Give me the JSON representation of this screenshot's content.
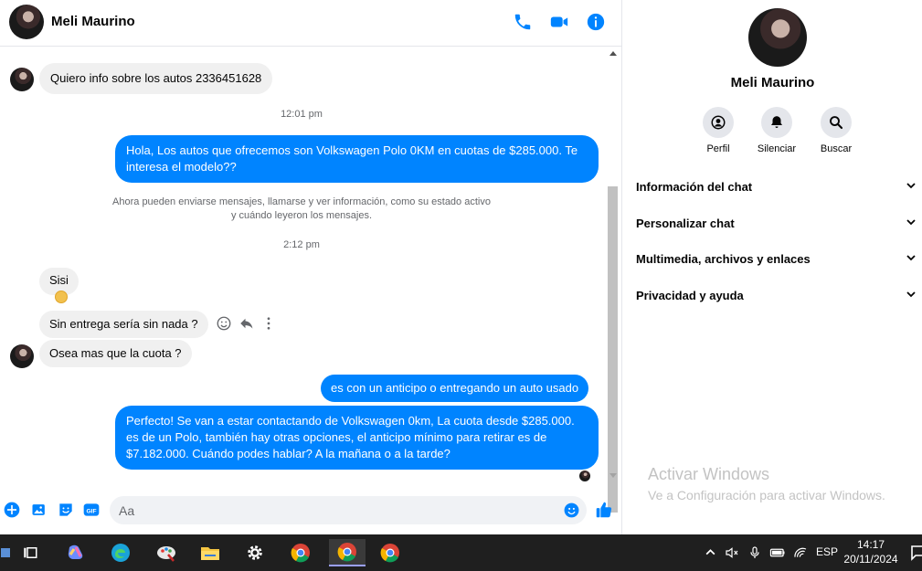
{
  "header": {
    "contact_name": "Meli Maurino"
  },
  "messages": [
    {
      "id": "m1",
      "dir": "in",
      "text": "Quiero info sobre los autos 2336451628"
    },
    {
      "id": "t1",
      "text": "12:01 pm"
    },
    {
      "id": "m2",
      "dir": "out",
      "text": "Hola, Los autos que ofrecemos son Volkswagen Polo 0KM en cuotas de $285.000. Te interesa el modelo??"
    },
    {
      "id": "sys",
      "line1": "Ahora pueden enviarse mensajes, llamarse y ver información, como su estado activo",
      "line2": "y cuándo leyeron los mensajes."
    },
    {
      "id": "t2",
      "text": "2:12 pm"
    },
    {
      "id": "m3",
      "dir": "in",
      "text": "Sisi"
    },
    {
      "id": "m4",
      "dir": "in",
      "text": "Sin entrega sería sin nada ?"
    },
    {
      "id": "m5",
      "dir": "in",
      "text": "Osea mas que la cuota ?"
    },
    {
      "id": "m6",
      "dir": "out",
      "text": "es con un anticipo o entregando un auto usado"
    },
    {
      "id": "m7",
      "dir": "out",
      "line1": "Perfecto!  Se van a estar contactando de Volkswagen 0km, La cuota desde $285.000.",
      "line2": "es de un Polo, también hay otras opciones, el anticipo mínimo para retirar es de",
      "line3": "$7.182.000. Cuándo podes hablar? A la mañana o a la tarde?"
    }
  ],
  "composer": {
    "placeholder": "Aa"
  },
  "sidebar": {
    "name": "Meli Maurino",
    "actions": [
      {
        "label": "Perfil"
      },
      {
        "label": "Silenciar"
      },
      {
        "label": "Buscar"
      }
    ],
    "sections": [
      {
        "label": "Información del chat"
      },
      {
        "label": "Personalizar chat"
      },
      {
        "label": "Multimedia, archivos y enlaces"
      },
      {
        "label": "Privacidad y ayuda"
      }
    ]
  },
  "watermark": {
    "title": "Activar Windows",
    "subtitle": "Ve a Configuración para activar Windows."
  },
  "taskbar": {
    "language": "ESP",
    "time": "14:17",
    "date": "20/11/2024",
    "apps": [
      "task-view",
      "copilot",
      "edge",
      "paint",
      "file-explorer",
      "settings",
      "chrome",
      "chrome",
      "chrome"
    ]
  },
  "colors": {
    "accent": "#0084ff",
    "incoming_bubble": "#f0f0f0",
    "taskbar": "#1f1f1f"
  }
}
